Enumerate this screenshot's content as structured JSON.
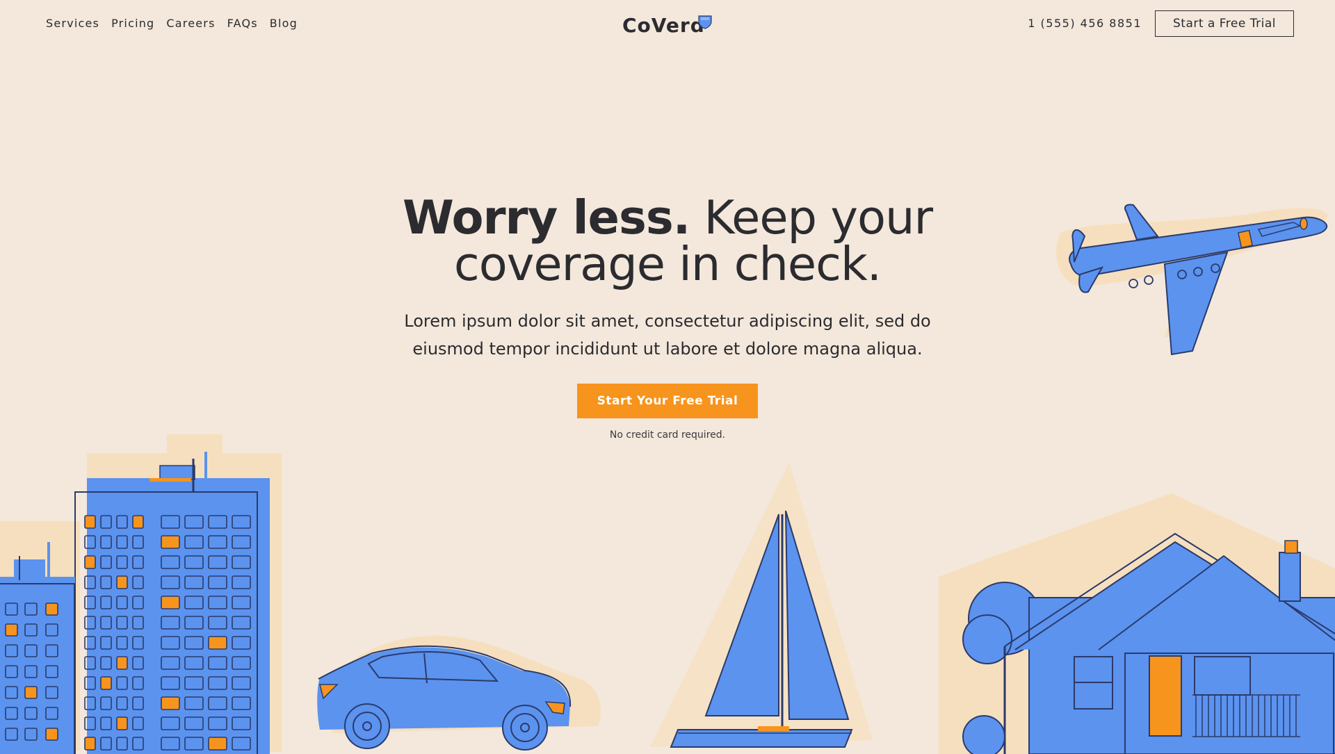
{
  "nav": {
    "items": [
      {
        "label": "Services"
      },
      {
        "label": "Pricing"
      },
      {
        "label": "Careers"
      },
      {
        "label": "FAQs"
      },
      {
        "label": "Blog"
      }
    ]
  },
  "brand": {
    "name": "CoVerd",
    "logo_icon": "shield-icon",
    "accent_color": "#5b93ef",
    "cta_color": "#f7941d",
    "background_color": "#f3e8db"
  },
  "header": {
    "phone": "1 (555) 456 8851",
    "trial_button_label": "Start a Free Trial"
  },
  "hero": {
    "headline_bold": "Worry less.",
    "headline_rest": " Keep your coverage in check.",
    "subtitle": "Lorem ipsum dolor sit amet, consectetur adipiscing elit, sed do eiusmod tempor incididunt ut labore et dolore magna aliqua.",
    "cta_label": "Start Your Free Trial",
    "note": "No credit card required."
  },
  "illustrations": [
    "airplane-illustration",
    "buildings-illustration",
    "car-illustration",
    "sailboat-illustration",
    "house-illustration"
  ]
}
